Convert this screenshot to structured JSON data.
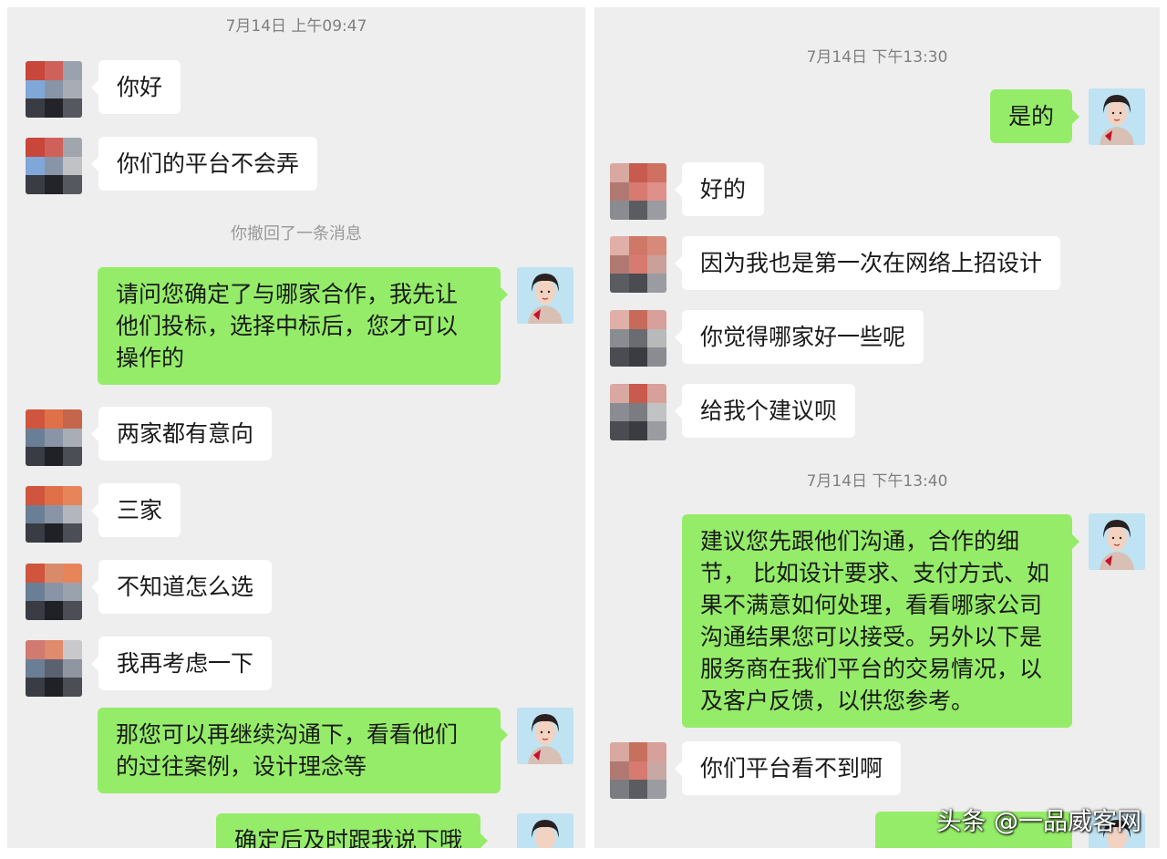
{
  "left_panel": {
    "timestamp": "7月14日 上午09:47",
    "recall_notice": "你撤回了一条消息",
    "messages": [
      {
        "from": "other",
        "text": "你好"
      },
      {
        "from": "other",
        "text": "你们的平台不会弄"
      },
      {
        "from": "self",
        "text": "请问您确定了与哪家合作，我先让\n他们投标，选择中标后，您才可以\n操作的"
      },
      {
        "from": "other",
        "text": "两家都有意向"
      },
      {
        "from": "other",
        "text": "三家"
      },
      {
        "from": "other",
        "text": "不知道怎么选"
      },
      {
        "from": "other",
        "text": "我再考虑一下"
      },
      {
        "from": "self",
        "text": "那您可以再继续沟通下，看看他们\n的过往案例，设计理念等"
      },
      {
        "from": "self",
        "text": "确定后及时跟我说下哦"
      }
    ]
  },
  "right_panel": {
    "timestamp_1": "7月14日 下午13:30",
    "timestamp_2": "7月14日 下午13:40",
    "messages": [
      {
        "from": "self",
        "text": "是的"
      },
      {
        "from": "other",
        "text": "好的"
      },
      {
        "from": "other",
        "text": "因为我也是第一次在网络上招设计"
      },
      {
        "from": "other",
        "text": "你觉得哪家好一些呢"
      },
      {
        "from": "other",
        "text": "给我个建议呗"
      },
      {
        "from": "self",
        "text": "建议您先跟他们沟通，合作的细\n节， 比如设计要求、支付方式、如\n果不满意如何处理，看看哪家公司\n沟通结果您可以接受。另外以下是\n服务商在我们平台的交易情况，以\n及客户反馈，以供您参考。"
      },
      {
        "from": "other",
        "text": "你们平台看不到啊"
      }
    ]
  },
  "watermark": "头条 @一品威客网",
  "colors": {
    "outgoing_bubble": "#95ec69",
    "incoming_bubble": "#ffffff",
    "chat_background": "#eeeeee"
  }
}
